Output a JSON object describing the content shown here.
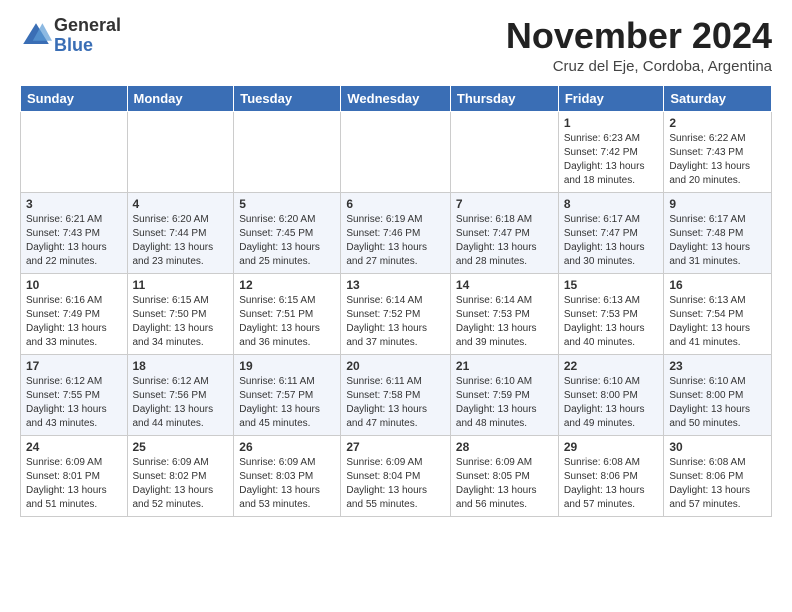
{
  "header": {
    "logo_general": "General",
    "logo_blue": "Blue",
    "month_title": "November 2024",
    "location": "Cruz del Eje, Cordoba, Argentina"
  },
  "days_of_week": [
    "Sunday",
    "Monday",
    "Tuesday",
    "Wednesday",
    "Thursday",
    "Friday",
    "Saturday"
  ],
  "weeks": [
    [
      {
        "day": "",
        "info": ""
      },
      {
        "day": "",
        "info": ""
      },
      {
        "day": "",
        "info": ""
      },
      {
        "day": "",
        "info": ""
      },
      {
        "day": "",
        "info": ""
      },
      {
        "day": "1",
        "info": "Sunrise: 6:23 AM\nSunset: 7:42 PM\nDaylight: 13 hours and 18 minutes."
      },
      {
        "day": "2",
        "info": "Sunrise: 6:22 AM\nSunset: 7:43 PM\nDaylight: 13 hours and 20 minutes."
      }
    ],
    [
      {
        "day": "3",
        "info": "Sunrise: 6:21 AM\nSunset: 7:43 PM\nDaylight: 13 hours and 22 minutes."
      },
      {
        "day": "4",
        "info": "Sunrise: 6:20 AM\nSunset: 7:44 PM\nDaylight: 13 hours and 23 minutes."
      },
      {
        "day": "5",
        "info": "Sunrise: 6:20 AM\nSunset: 7:45 PM\nDaylight: 13 hours and 25 minutes."
      },
      {
        "day": "6",
        "info": "Sunrise: 6:19 AM\nSunset: 7:46 PM\nDaylight: 13 hours and 27 minutes."
      },
      {
        "day": "7",
        "info": "Sunrise: 6:18 AM\nSunset: 7:47 PM\nDaylight: 13 hours and 28 minutes."
      },
      {
        "day": "8",
        "info": "Sunrise: 6:17 AM\nSunset: 7:47 PM\nDaylight: 13 hours and 30 minutes."
      },
      {
        "day": "9",
        "info": "Sunrise: 6:17 AM\nSunset: 7:48 PM\nDaylight: 13 hours and 31 minutes."
      }
    ],
    [
      {
        "day": "10",
        "info": "Sunrise: 6:16 AM\nSunset: 7:49 PM\nDaylight: 13 hours and 33 minutes."
      },
      {
        "day": "11",
        "info": "Sunrise: 6:15 AM\nSunset: 7:50 PM\nDaylight: 13 hours and 34 minutes."
      },
      {
        "day": "12",
        "info": "Sunrise: 6:15 AM\nSunset: 7:51 PM\nDaylight: 13 hours and 36 minutes."
      },
      {
        "day": "13",
        "info": "Sunrise: 6:14 AM\nSunset: 7:52 PM\nDaylight: 13 hours and 37 minutes."
      },
      {
        "day": "14",
        "info": "Sunrise: 6:14 AM\nSunset: 7:53 PM\nDaylight: 13 hours and 39 minutes."
      },
      {
        "day": "15",
        "info": "Sunrise: 6:13 AM\nSunset: 7:53 PM\nDaylight: 13 hours and 40 minutes."
      },
      {
        "day": "16",
        "info": "Sunrise: 6:13 AM\nSunset: 7:54 PM\nDaylight: 13 hours and 41 minutes."
      }
    ],
    [
      {
        "day": "17",
        "info": "Sunrise: 6:12 AM\nSunset: 7:55 PM\nDaylight: 13 hours and 43 minutes."
      },
      {
        "day": "18",
        "info": "Sunrise: 6:12 AM\nSunset: 7:56 PM\nDaylight: 13 hours and 44 minutes."
      },
      {
        "day": "19",
        "info": "Sunrise: 6:11 AM\nSunset: 7:57 PM\nDaylight: 13 hours and 45 minutes."
      },
      {
        "day": "20",
        "info": "Sunrise: 6:11 AM\nSunset: 7:58 PM\nDaylight: 13 hours and 47 minutes."
      },
      {
        "day": "21",
        "info": "Sunrise: 6:10 AM\nSunset: 7:59 PM\nDaylight: 13 hours and 48 minutes."
      },
      {
        "day": "22",
        "info": "Sunrise: 6:10 AM\nSunset: 8:00 PM\nDaylight: 13 hours and 49 minutes."
      },
      {
        "day": "23",
        "info": "Sunrise: 6:10 AM\nSunset: 8:00 PM\nDaylight: 13 hours and 50 minutes."
      }
    ],
    [
      {
        "day": "24",
        "info": "Sunrise: 6:09 AM\nSunset: 8:01 PM\nDaylight: 13 hours and 51 minutes."
      },
      {
        "day": "25",
        "info": "Sunrise: 6:09 AM\nSunset: 8:02 PM\nDaylight: 13 hours and 52 minutes."
      },
      {
        "day": "26",
        "info": "Sunrise: 6:09 AM\nSunset: 8:03 PM\nDaylight: 13 hours and 53 minutes."
      },
      {
        "day": "27",
        "info": "Sunrise: 6:09 AM\nSunset: 8:04 PM\nDaylight: 13 hours and 55 minutes."
      },
      {
        "day": "28",
        "info": "Sunrise: 6:09 AM\nSunset: 8:05 PM\nDaylight: 13 hours and 56 minutes."
      },
      {
        "day": "29",
        "info": "Sunrise: 6:08 AM\nSunset: 8:06 PM\nDaylight: 13 hours and 57 minutes."
      },
      {
        "day": "30",
        "info": "Sunrise: 6:08 AM\nSunset: 8:06 PM\nDaylight: 13 hours and 57 minutes."
      }
    ]
  ]
}
